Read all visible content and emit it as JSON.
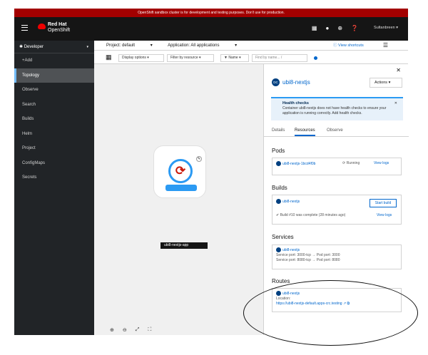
{
  "banner": "OpenShift sandbox cluster is for development and testing purposes. Don't use for production.",
  "masthead": {
    "brand_line1": "Red Hat",
    "brand_line2": "OpenShift",
    "icons": [
      "grid-icon",
      "bell-icon",
      "plus-icon",
      "help-icon"
    ],
    "user": "Sultanbreen"
  },
  "sidebar": {
    "perspective": "Developer",
    "items": [
      "+Add",
      "Topology",
      "Observe",
      "Search",
      "Builds",
      "Helm",
      "Project",
      "ConfigMaps",
      "Secrets"
    ],
    "active": "Topology"
  },
  "context": {
    "project": "Project: default",
    "application": "Application: All applications",
    "shortcuts": "View shortcuts"
  },
  "toolbar": {
    "display_options": "Display options",
    "filter_by_resource": "Filter by resource",
    "name_filter": "Name",
    "search_placeholder": "Find by name..."
  },
  "canvas": {
    "app_label": "ubi8-nextjs-app"
  },
  "drawer": {
    "resource_badge": "DC",
    "resource_name": "ubi8-nextjs",
    "actions": "Actions",
    "alert_title": "Health checks",
    "alert_body": "Container ubi8-nextjs does not have health checks to ensure your application is running correctly. Add health checks.",
    "tabs": [
      "Details",
      "Resources",
      "Observe"
    ],
    "active_tab": "Resources",
    "pods_title": "Pods",
    "pod_name": "ubi8-nextjs-1bcd4f0b",
    "pod_status": "Running",
    "view_logs": "View logs",
    "builds_title": "Builds",
    "build_config": "ubi8-nextjs",
    "start_build": "Start build",
    "build_status": "Build #10 was complete (28 minutes ago)",
    "services_title": "Services",
    "service_name": "ubi8-nextjs",
    "service_port1": "Service port: 3000-tcp → Pod port: 3000",
    "service_port2": "Service port: 8080-tcp → Pod port: 8080",
    "routes_title": "Routes",
    "route_name": "ubi8-nextjs",
    "location_label": "Location:",
    "route_url": "https://ubi8-nextjs-default.apps-crc.testing"
  }
}
